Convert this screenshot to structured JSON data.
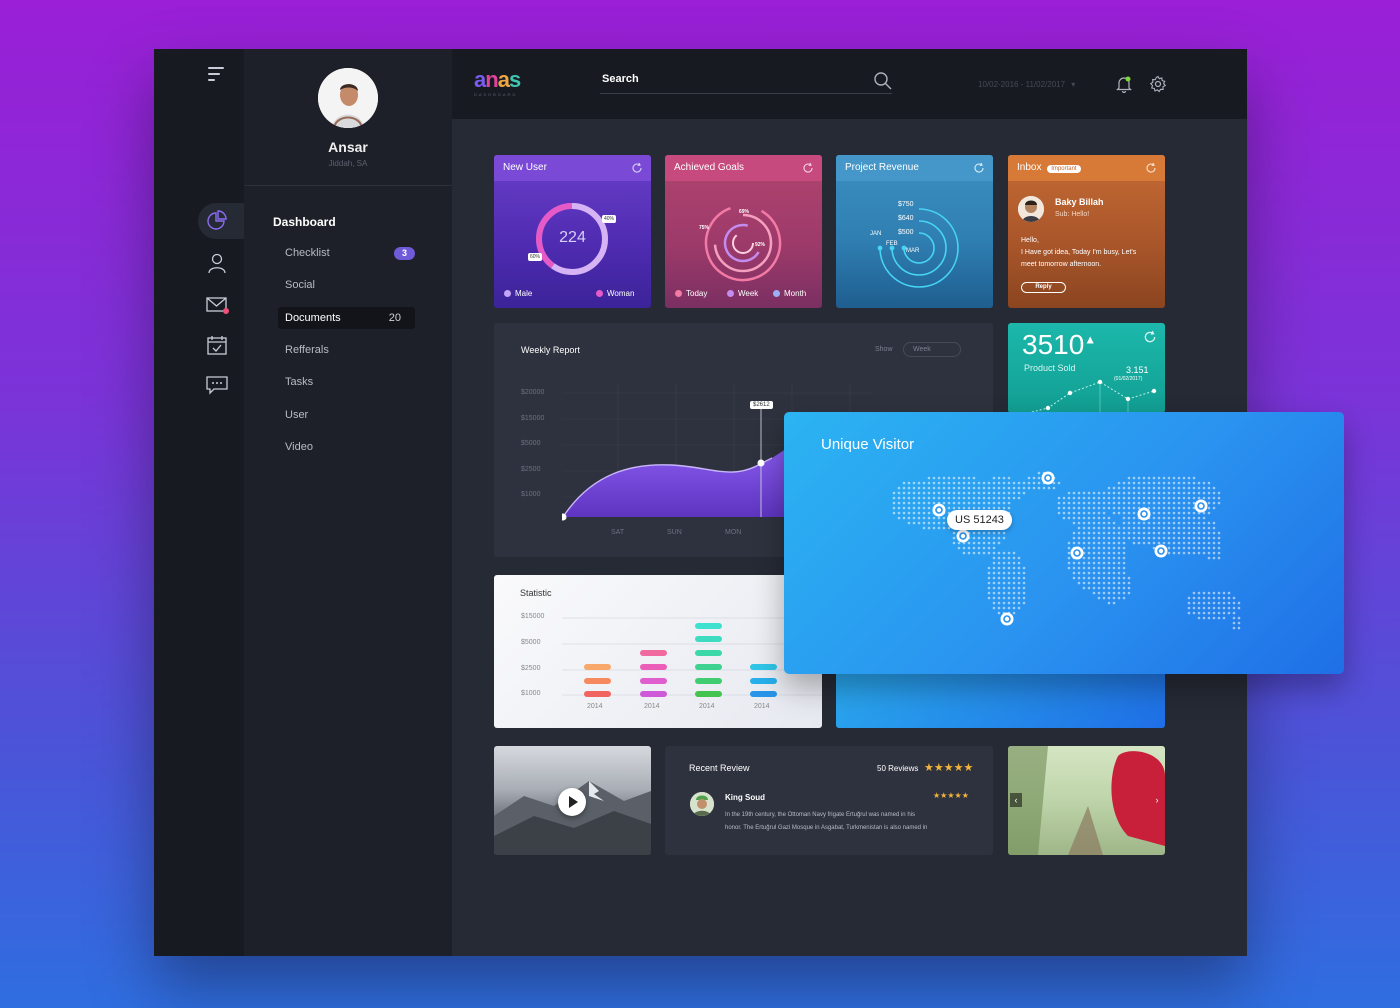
{
  "app": {
    "logo_text": "anas",
    "logo_sub": "DASHBOARD",
    "search_label": "Search",
    "date_range": "10/02-2016 - 11/02/2017"
  },
  "colors": {
    "new_user": "#5b2fbf",
    "achieved_goals": "#c64a7e",
    "project_revenue": "#2f7fb3",
    "inbox": "#d77a38",
    "product_sold": "#17b1a6",
    "unique_visitor": "#2a93f0",
    "accent_purple": "#6f5bd8"
  },
  "profile": {
    "name": "Ansar",
    "location": "Jiddah, SA"
  },
  "nav": {
    "title": "Dashboard",
    "items": [
      {
        "label": "Checklist",
        "badge": "3"
      },
      {
        "label": "Social"
      },
      {
        "label": "Documents",
        "count": "20"
      },
      {
        "label": "Refferals"
      },
      {
        "label": "Tasks"
      },
      {
        "label": "User"
      },
      {
        "label": "Video"
      }
    ]
  },
  "cards": {
    "new_user": {
      "title": "New User",
      "value": "224",
      "pct_a": "40%",
      "pct_b": "60%",
      "legend_male": "Male",
      "legend_woman": "Woman"
    },
    "achieved_goals": {
      "title": "Achieved Goals",
      "p1": "69%",
      "p2": "75%",
      "p3": "92%",
      "legend_today": "Today",
      "legend_week": "Week",
      "legend_month": "Month"
    },
    "project_revenue": {
      "title": "Project Revenue",
      "v1": "$750",
      "v2": "$640",
      "v3": "$500",
      "m1": "JAN",
      "m2": "FEB",
      "m3": "MAR"
    },
    "inbox": {
      "title": "Inbox",
      "tag": "Important",
      "sender": "Baky Billah",
      "subject": "Sub: Hello!",
      "body_l1": "Hello,",
      "body_l2": "I Have got idea, Today I'm busy, Let's",
      "body_l3": "meet tomorrow afternoon.",
      "reply": "Reply"
    },
    "product_sold": {
      "value": "3510",
      "label": "Product Sold",
      "point_value": "3.151",
      "point_date": "(01/02/2017)"
    }
  },
  "weekly_report": {
    "title": "Weekly Report",
    "show_label": "Show",
    "period": "Week",
    "tooltip": "$2612",
    "y_labels": [
      "$20000",
      "$15000",
      "$5000",
      "$2500",
      "$1000"
    ],
    "x_labels": [
      "SAT",
      "SUN",
      "MON"
    ]
  },
  "statistic": {
    "title": "Statistic",
    "y_labels": [
      "$15000",
      "$5000",
      "$2500",
      "$1000"
    ],
    "x_labels": [
      "2014",
      "2014",
      "2014",
      "2014"
    ]
  },
  "unique_visitor": {
    "title": "Unique Visitor",
    "tooltip": "US 51243"
  },
  "recent_review": {
    "title": "Recent Review",
    "count": "50 Reviews",
    "stars": "★★★★★",
    "reviewer": "King Soud",
    "reviewer_stars": "★★★★★",
    "text_l1": "In the 19th century, the Ottoman Navy frigate Ertuğrul was named in his",
    "text_l2": "honor. The Ertuğrul Gazi Mosque in Asgabat, Turkmenistan is also named in"
  },
  "chart_data": [
    {
      "type": "area",
      "title": "Weekly Report",
      "x": [
        "SAT",
        "SUN",
        "MON"
      ],
      "y_ticks": [
        "$20000",
        "$15000",
        "$5000",
        "$2500",
        "$1000"
      ],
      "annotations": [
        "$2612"
      ]
    },
    {
      "type": "bar",
      "title": "Statistic",
      "categories": [
        "2014",
        "2014",
        "2014",
        "2014"
      ],
      "y_ticks": [
        "$15000",
        "$5000",
        "$2500",
        "$1000"
      ]
    }
  ]
}
